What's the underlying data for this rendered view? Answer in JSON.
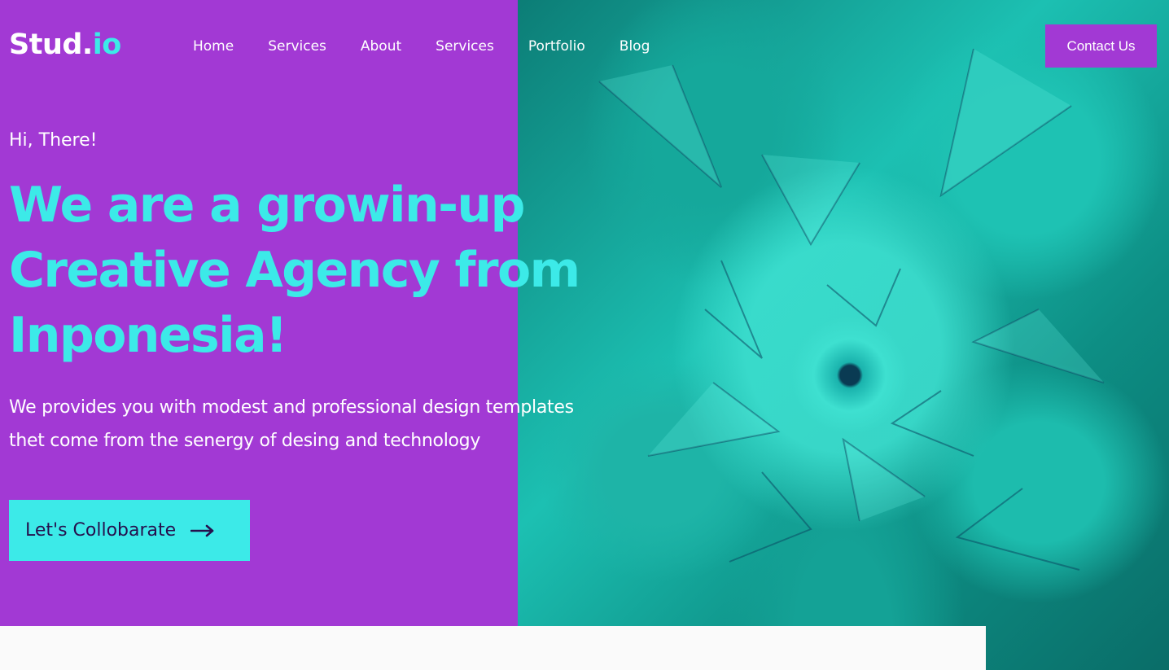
{
  "brand": {
    "logo_main": "Stud.",
    "logo_accent": "io"
  },
  "nav": {
    "items": [
      {
        "label": "Home"
      },
      {
        "label": "Services"
      },
      {
        "label": "About"
      },
      {
        "label": "Services"
      },
      {
        "label": "Portfolio"
      },
      {
        "label": "Blog"
      }
    ]
  },
  "header": {
    "contact_label": "Contact Us"
  },
  "hero": {
    "greeting": "Hi, There!",
    "headline_lines": [
      "We are a growin-up",
      "Creative Agency from",
      "Inponesia!"
    ],
    "description_lines": [
      "We provides you with modest and professional design templates",
      "thet come from the senergy of desing and technology"
    ],
    "cta_label": "Let's Collobarate",
    "cta_icon": "arrow-right-icon",
    "image": "agave-succulent-photo"
  },
  "colors": {
    "purple": "#a239d4",
    "cyan": "#3ceae8",
    "cta_text": "#26104d",
    "white": "#ffffff"
  }
}
